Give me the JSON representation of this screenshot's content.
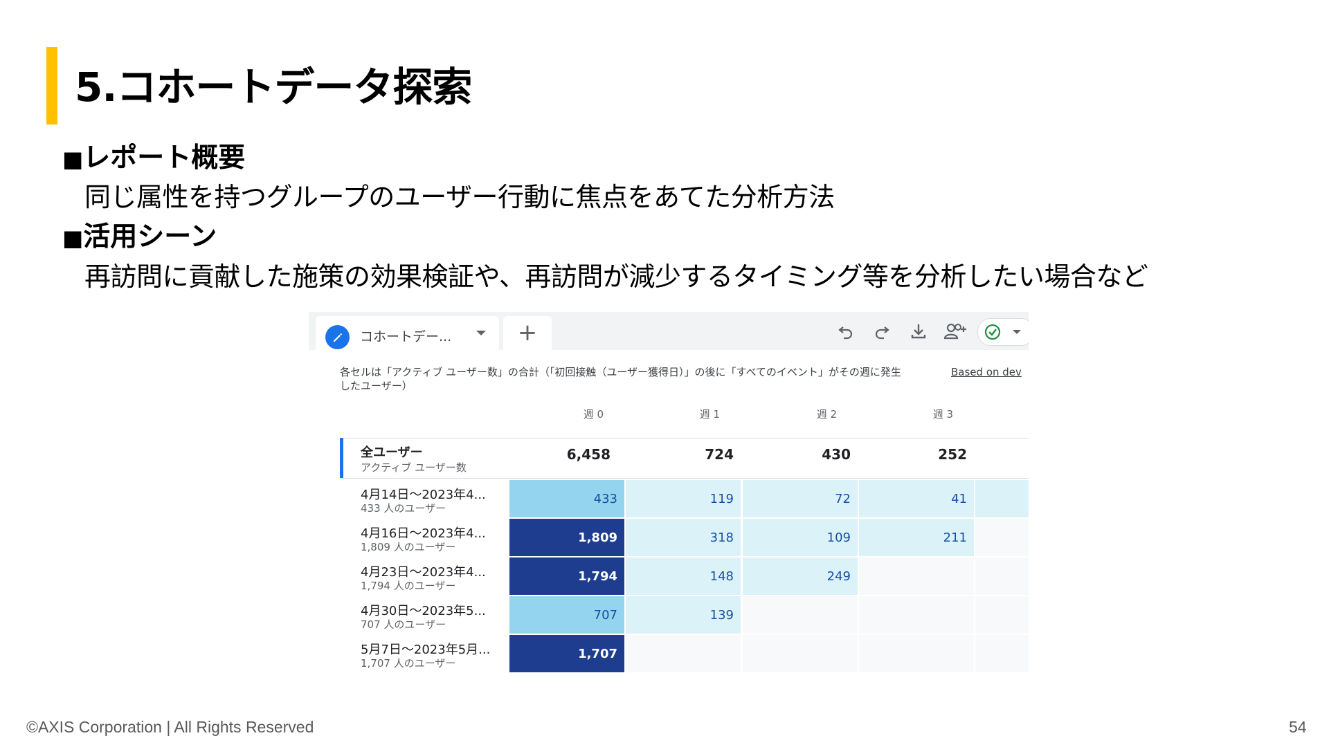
{
  "slide": {
    "title": "5.コホートデータ探索",
    "sections": [
      {
        "heading": "レポート概要",
        "body": "同じ属性を持つグループのユーザー行動に焦点をあてた分析方法"
      },
      {
        "heading": "活用シーン",
        "body": "再訪問に貢献した施策の効果検証や、再訪問が減少するタイミング等を分析したい場合など"
      }
    ],
    "bullet": "■",
    "footer": "©AXIS Corporation | All Rights Reserved",
    "page_number": "54"
  },
  "colors": {
    "title_accent": "#FFC000",
    "cell_dark": "#1E3D8F",
    "cell_mid": "#95D4EE",
    "cell_light": "#DAF2F8",
    "cell_empty": "#F8F9FA",
    "primary_blue": "#1A73E8",
    "check_green": "#1E8E3E"
  },
  "report": {
    "tab_name": "コホートデー...",
    "add_tab_label": "+",
    "toolbar_icons": [
      "undo-icon",
      "redo-icon",
      "download-icon",
      "share-user-icon",
      "check-circle-icon"
    ],
    "caption": "各セルは「アクティブ ユーザー数」の合計（「初回接触（ユーザー獲得日）」の後に「すべてのイベント」がその週に発生したユーザー）",
    "based_on": "Based on dev",
    "weeks": [
      "週 0",
      "週 1",
      "週 2",
      "週 3"
    ],
    "total": {
      "label": "全ユーザー",
      "sub": "アクティブ ユーザー数",
      "values": [
        "6,458",
        "724",
        "430",
        "252"
      ]
    },
    "rows": [
      {
        "label": "4月14日～2023年4...",
        "sub": "433 人のユーザー",
        "values": [
          "433",
          "119",
          "72",
          "41"
        ],
        "levels": [
          "mid",
          "light",
          "light",
          "light"
        ],
        "extra": "light"
      },
      {
        "label": "4月16日～2023年4...",
        "sub": "1,809 人のユーザー",
        "values": [
          "1,809",
          "318",
          "109",
          "211"
        ],
        "levels": [
          "dark",
          "light",
          "light",
          "light"
        ],
        "extra": "empty"
      },
      {
        "label": "4月23日～2023年4...",
        "sub": "1,794 人のユーザー",
        "values": [
          "1,794",
          "148",
          "249",
          ""
        ],
        "levels": [
          "dark",
          "light",
          "light",
          "empty"
        ],
        "extra": "empty"
      },
      {
        "label": "4月30日～2023年5...",
        "sub": "707 人のユーザー",
        "values": [
          "707",
          "139",
          "",
          ""
        ],
        "levels": [
          "mid",
          "light",
          "empty",
          "empty"
        ],
        "extra": "empty"
      },
      {
        "label": "5月7日～2023年5月...",
        "sub": "1,707 人のユーザー",
        "values": [
          "1,707",
          "",
          "",
          ""
        ],
        "levels": [
          "dark",
          "empty",
          "empty",
          "empty"
        ],
        "extra": "empty"
      }
    ]
  }
}
